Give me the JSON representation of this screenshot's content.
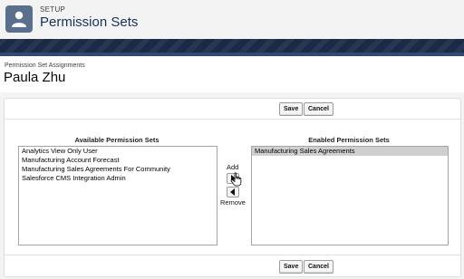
{
  "header": {
    "eyebrow": "SETUP",
    "title": "Permission Sets",
    "icon": "user-icon"
  },
  "assignment": {
    "label": "Permission Set Assignments",
    "user_name": "Paula Zhu"
  },
  "buttons": {
    "save": "Save",
    "cancel": "Cancel"
  },
  "available": {
    "heading": "Available Permission Sets",
    "options": [
      "Analytics View Only User",
      "Manufacturing Account Forecast",
      "Manufacturing Sales Agreements For Community",
      "Salesforce CMS Integration Admin"
    ]
  },
  "enabled": {
    "heading": "Enabled Permission Sets",
    "options": [
      "Manufacturing Sales Agreements"
    ],
    "selected_index": 0
  },
  "mover": {
    "add_label": "Add",
    "remove_label": "Remove",
    "add_icon": "arrow-right-icon",
    "remove_icon": "arrow-left-icon"
  },
  "colors": {
    "banner": "#1b2a47",
    "icon_bg": "#5a6f8e",
    "title": "#16325c"
  }
}
